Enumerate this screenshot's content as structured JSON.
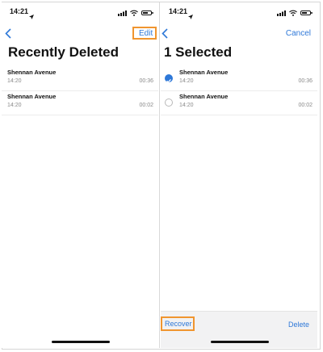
{
  "status": {
    "time": "14:21"
  },
  "left": {
    "nav_action": "Edit",
    "title": "Recently Deleted",
    "items": [
      {
        "name": "Shennan Avenue",
        "time": "14:20",
        "duration": "00:36"
      },
      {
        "name": "Shennan Avenue",
        "time": "14:20",
        "duration": "00:02"
      }
    ]
  },
  "right": {
    "nav_action": "Cancel",
    "title": "1 Selected",
    "items": [
      {
        "name": "Shennan Avenue",
        "time": "14:20",
        "duration": "00:36",
        "selected": true
      },
      {
        "name": "Shennan Avenue",
        "time": "14:20",
        "duration": "00:02",
        "selected": false
      }
    ],
    "toolbar": {
      "recover_label": "Recover",
      "delete_label": "Delete"
    }
  },
  "colors": {
    "accent": "#2e78d8",
    "highlight": "#f0952f"
  },
  "icons": [
    "location-arrow-icon",
    "cellular-signal-icon",
    "wifi-icon",
    "battery-icon",
    "back-chevron-icon",
    "checkmark-icon"
  ]
}
